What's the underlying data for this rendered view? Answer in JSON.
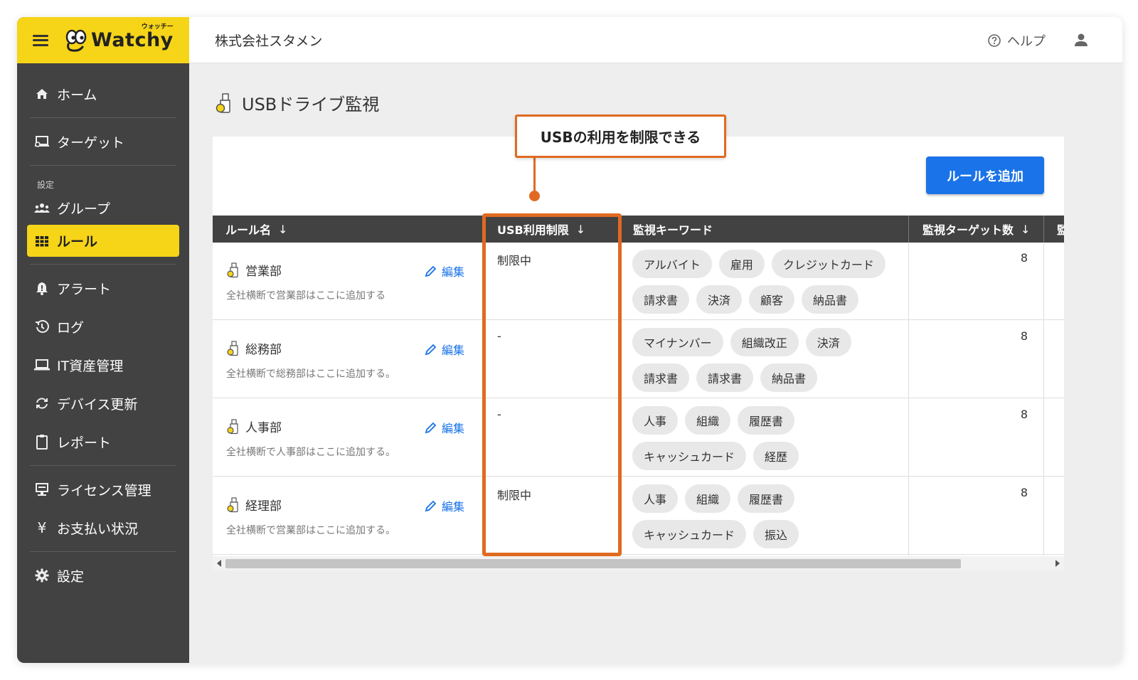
{
  "app": {
    "logo_text": "Watchy",
    "logo_ruby": "ウォッチー",
    "company": "株式会社スタメン",
    "help_label": "ヘルプ"
  },
  "sidebar": {
    "items_top": [
      {
        "label": "ホーム",
        "icon": "home-icon"
      },
      {
        "label": "ターゲット",
        "icon": "target-computer-icon"
      }
    ],
    "section_label": "設定",
    "items_settings": [
      {
        "label": "グループ",
        "icon": "group-icon"
      },
      {
        "label": "ルール",
        "icon": "grid-icon",
        "active": true
      }
    ],
    "items_ops": [
      {
        "label": "アラート",
        "icon": "alert-bell-icon"
      },
      {
        "label": "ログ",
        "icon": "history-icon"
      },
      {
        "label": "IT資産管理",
        "icon": "laptop-icon"
      },
      {
        "label": "デバイス更新",
        "icon": "sync-icon"
      },
      {
        "label": "レポート",
        "icon": "clipboard-icon"
      }
    ],
    "items_billing": [
      {
        "label": "ライセンス管理",
        "icon": "license-icon"
      },
      {
        "label": "お支払い状況",
        "icon": "yen-icon"
      }
    ],
    "items_bottom": [
      {
        "label": "設定",
        "icon": "gear-icon"
      }
    ]
  },
  "page": {
    "title": "USBドライブ監視",
    "add_button": "ルールを追加"
  },
  "table": {
    "columns": [
      {
        "label": "ルール名",
        "sort": "↓"
      },
      {
        "label": "USB利用制限",
        "sort": "↓"
      },
      {
        "label": "監視キーワード",
        "sort": ""
      },
      {
        "label": "監視ターゲット数",
        "sort": "↓"
      },
      {
        "label": "監",
        "sort": ""
      }
    ],
    "edit_label": "編集",
    "rows": [
      {
        "name": "営業部",
        "desc": "全社横断で営業部はここに追加する",
        "usb": "制限中",
        "keywords": [
          "アルバイト",
          "雇用",
          "クレジットカード",
          "請求書",
          "決済",
          "顧客",
          "納品書"
        ],
        "count": "8"
      },
      {
        "name": "総務部",
        "desc": "全社横断で総務部はここに追加する。",
        "usb": "-",
        "keywords": [
          "マイナンバー",
          "組織改正",
          "決済",
          "請求書",
          "請求書",
          "納品書"
        ],
        "count": "8"
      },
      {
        "name": "人事部",
        "desc": "全社横断で人事部はここに追加する。",
        "usb": "-",
        "keywords": [
          "人事",
          "組織",
          "履歴書",
          "キャッシュカード",
          "経歴"
        ],
        "count": "8"
      },
      {
        "name": "経理部",
        "desc": "全社横断で営業部はここに追加する。",
        "usb": "制限中",
        "keywords": [
          "人事",
          "組織",
          "履歴書",
          "キャッシュカード",
          "振込"
        ],
        "count": "8"
      }
    ]
  },
  "annotation": {
    "callout": "USBの利用を制限できる",
    "color": "#e06a21"
  },
  "colors": {
    "brand_yellow": "#f6d418",
    "sidebar_bg": "#424242",
    "primary_blue": "#1a73e8"
  }
}
